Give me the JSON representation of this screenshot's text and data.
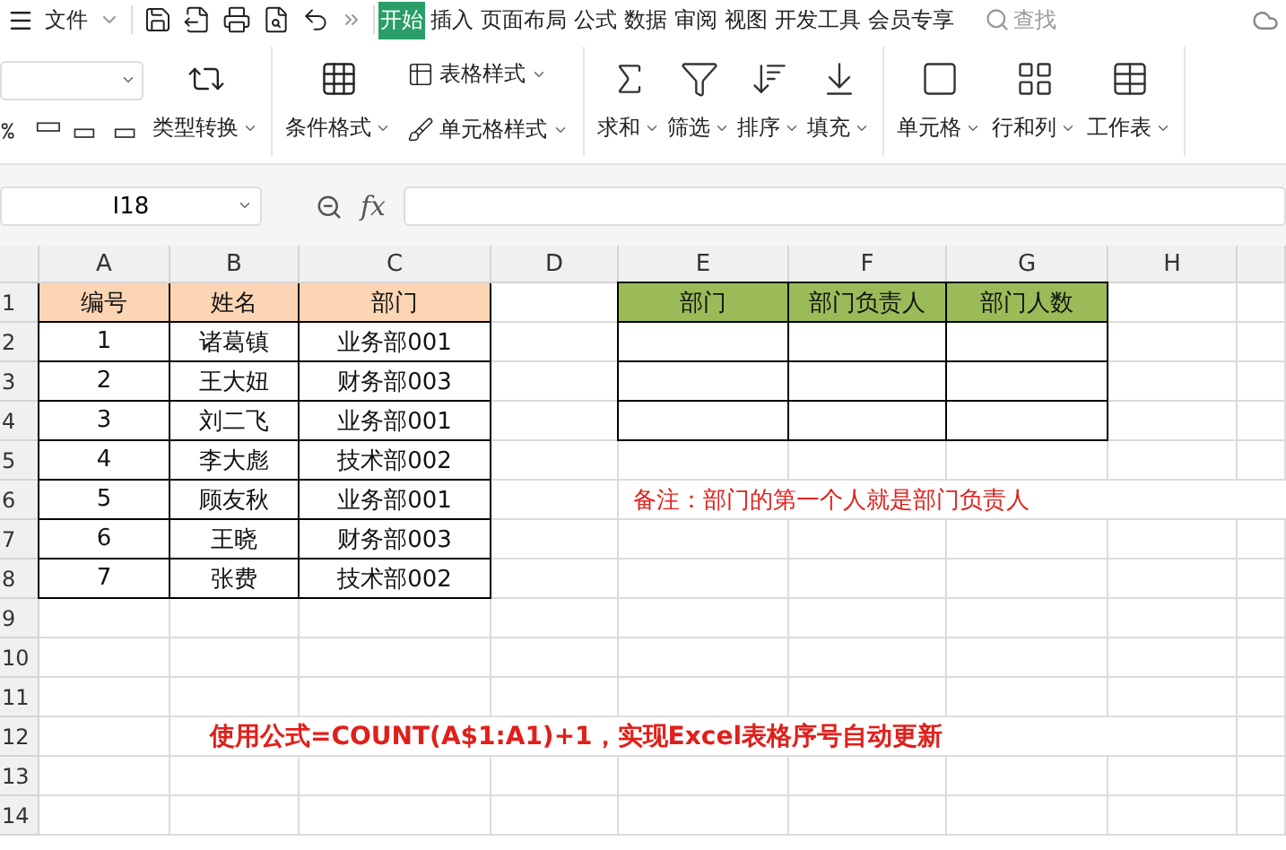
{
  "menu": {
    "file": "文件",
    "tabs": [
      {
        "label": "开始",
        "selected": true
      },
      {
        "label": "插入",
        "selected": false
      },
      {
        "label": "页面布局",
        "selected": false
      },
      {
        "label": "公式",
        "selected": false
      },
      {
        "label": "数据",
        "selected": false
      },
      {
        "label": "审阅",
        "selected": false
      },
      {
        "label": "视图",
        "selected": false
      },
      {
        "label": "开发工具",
        "selected": false
      },
      {
        "label": "会员专享",
        "selected": false
      }
    ],
    "search": "查找"
  },
  "ribbon": {
    "convert": "类型转换",
    "conditional": "条件格式",
    "table_style": "表格样式",
    "cell_style": "单元格样式",
    "tools": [
      {
        "kind": "sum",
        "label": "求和"
      },
      {
        "kind": "filter",
        "label": "筛选"
      },
      {
        "kind": "sort",
        "label": "排序"
      },
      {
        "kind": "fill",
        "label": "填充"
      },
      {
        "kind": "cell",
        "label": "单元格"
      },
      {
        "kind": "rowcol",
        "label": "行和列"
      },
      {
        "kind": "sheet",
        "label": "工作表"
      }
    ]
  },
  "formula_bar": {
    "cell_ref": "I18",
    "function_label": "fx"
  },
  "sheet": {
    "columns": [
      "A",
      "B",
      "C",
      "D",
      "E",
      "F",
      "G",
      "H"
    ],
    "rows": [
      "1",
      "2",
      "3",
      "4",
      "5",
      "6",
      "7",
      "8",
      "9",
      "10",
      "11",
      "12",
      "13",
      "14"
    ],
    "table": {
      "headers": [
        "编号",
        "姓名",
        "部门"
      ],
      "rows": [
        [
          "1",
          "诸葛镇",
          "业务部001"
        ],
        [
          "2",
          "王大妞",
          "财务部003"
        ],
        [
          "3",
          "刘二飞",
          "业务部001"
        ],
        [
          "4",
          "李大彪",
          "技术部002"
        ],
        [
          "5",
          "顾友秋",
          "业务部001"
        ],
        [
          "6",
          "王晓",
          "财务部003"
        ],
        [
          "7",
          "张费",
          "技术部002"
        ]
      ]
    },
    "summary_headers": [
      "部门",
      "部门负责人",
      "部门人数"
    ],
    "note": "备注：部门的第一个人就是部门负责人",
    "banner": "使用公式=COUNT(A$1:A1)+1，实现Excel表格序号自动更新"
  }
}
